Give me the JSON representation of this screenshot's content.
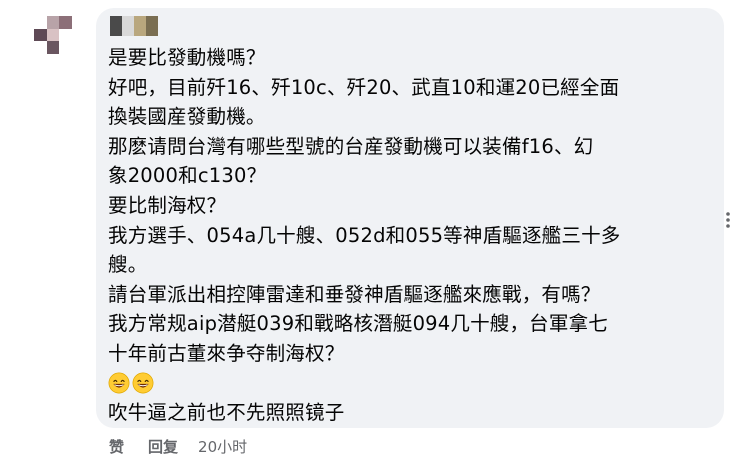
{
  "comment": {
    "lines": [
      "是要比發動機嗎？",
      "好吧，目前歼16、歼10c、歼20、武直10和運20已經全面",
      "換裝國産發動機。",
      "那麽请問台灣有哪些型號的台産發動機可以装備f16、幻",
      "象2000和c130？",
      "要比制海权？",
      "我方選手、054a几十艘、052d和055等神盾驅逐艦三十多",
      "艘。",
      "請台軍派出相控陣雷達和垂發神盾驅逐艦來應戰，有嗎？",
      "我方常规aip潜艇039和戰略核潛艇094几十艘，台軍拿七",
      "十年前古董來争夺制海权？",
      "吹牛逼之前也不先照照镜子"
    ],
    "emojis": [
      "grinning-face-icon",
      "grinning-face-icon"
    ]
  },
  "actions": {
    "like_label": "赞",
    "reply_label": "回复",
    "timestamp": "20小时"
  },
  "colors": {
    "bubble_bg": "#f0f2f5",
    "text": "#050505",
    "secondary_text": "#65676b"
  }
}
